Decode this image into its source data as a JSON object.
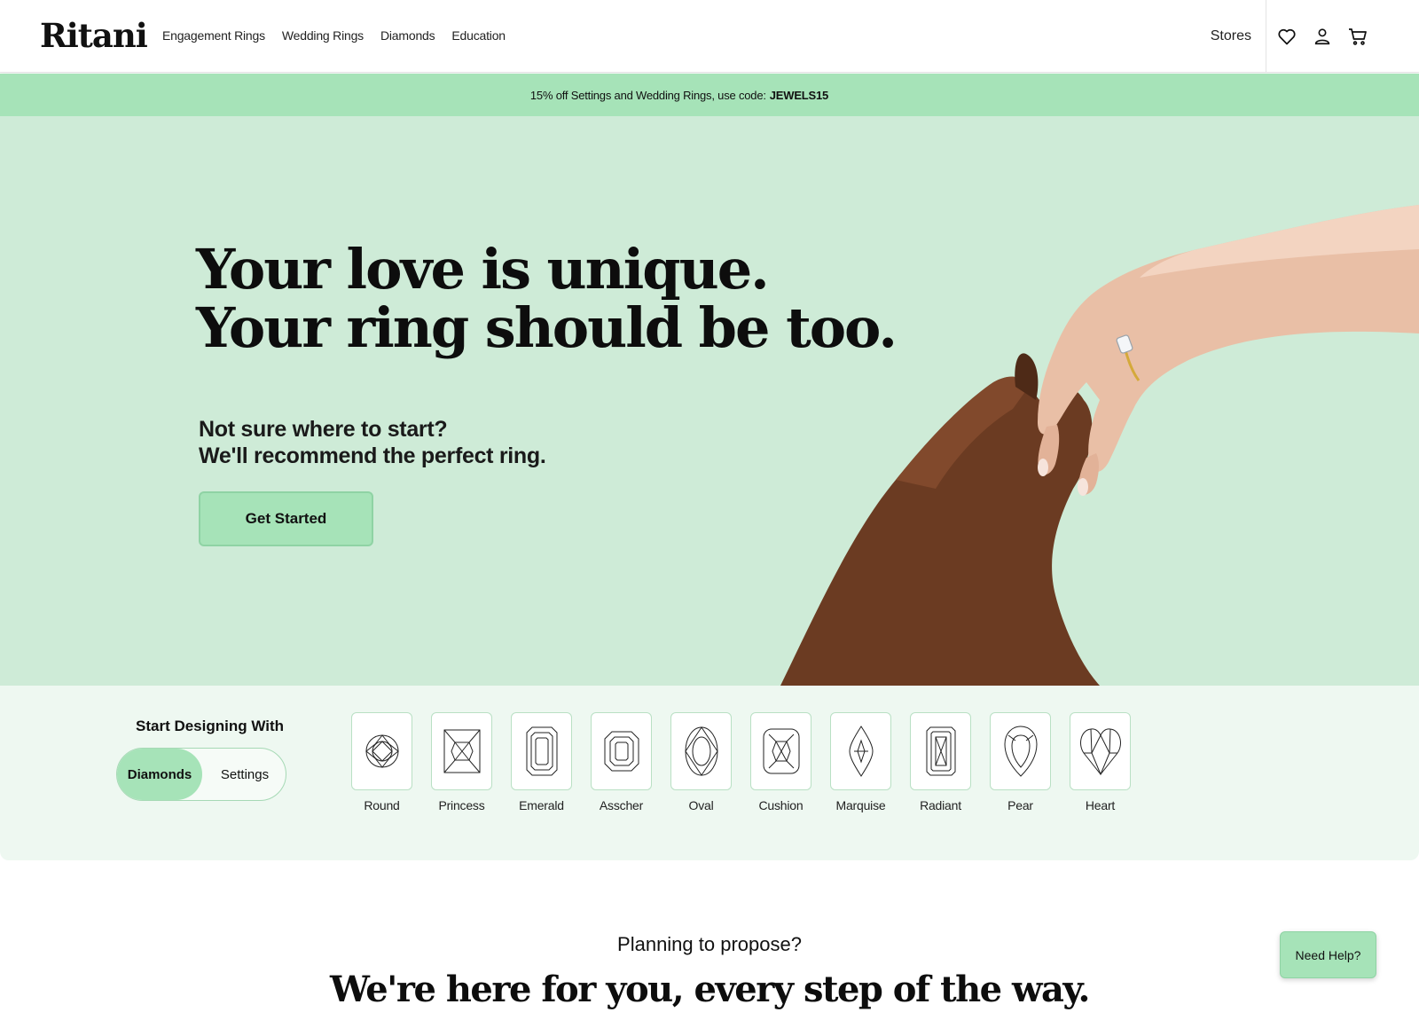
{
  "header": {
    "logo": "Ritani",
    "nav": [
      "Engagement Rings",
      "Wedding Rings",
      "Diamonds",
      "Education"
    ],
    "stores": "Stores",
    "icons": [
      "heart-icon",
      "user-icon",
      "cart-icon"
    ]
  },
  "promo": {
    "text": "15% off Settings and Wedding Rings, use code:",
    "code": "JEWELS15"
  },
  "hero": {
    "title_line1": "Your love is unique.",
    "title_line2": "Your ring should be too.",
    "sub_line1": "Not sure where to start?",
    "sub_line2": "We'll recommend the perfect ring.",
    "cta": "Get Started"
  },
  "designer": {
    "label": "Start Designing With",
    "toggle": [
      "Diamonds",
      "Settings"
    ],
    "selected": "Diamonds",
    "shapes": [
      "Round",
      "Princess",
      "Emerald",
      "Asscher",
      "Oval",
      "Cushion",
      "Marquise",
      "Radiant",
      "Pear",
      "Heart"
    ]
  },
  "section": {
    "eyebrow": "Planning to propose?",
    "headline": "We're here for you, every step of the way."
  },
  "help": {
    "label": "Need Help?"
  },
  "colors": {
    "promo_bg": "#a6e3b8",
    "hero_bg": "#ceebd7",
    "shapes_bg": "#eef8f1",
    "accent": "#a6e3b8"
  }
}
